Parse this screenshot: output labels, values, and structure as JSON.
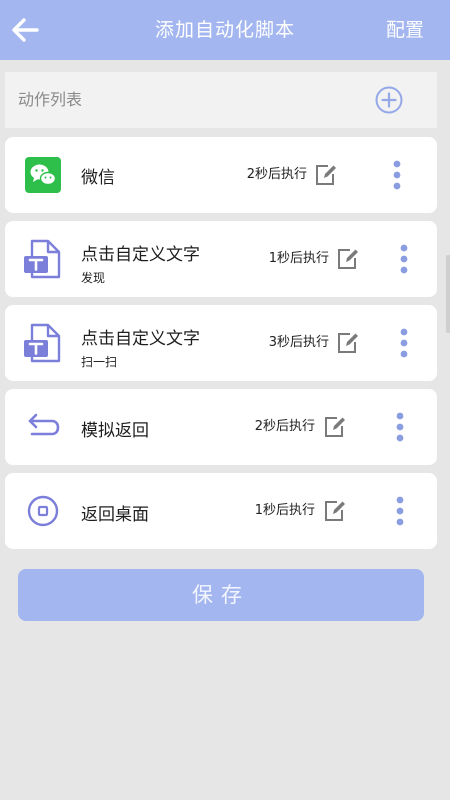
{
  "header": {
    "title": "添加自动化脚本",
    "config_label": "配置"
  },
  "list": {
    "label": "动作列表"
  },
  "actions": [
    {
      "title": "微信",
      "subtitle": "",
      "delay": "2秒后执行",
      "icon": "wechat-icon"
    },
    {
      "title": "点击自定义文字",
      "subtitle": "发现",
      "delay": "1秒后执行",
      "icon": "text-tool-icon"
    },
    {
      "title": "点击自定义文字",
      "subtitle": "扫一扫",
      "delay": "3秒后执行",
      "icon": "text-tool-icon"
    },
    {
      "title": "模拟返回",
      "subtitle": "",
      "delay": "2秒后执行",
      "icon": "back-arrow-icon"
    },
    {
      "title": "返回桌面",
      "subtitle": "",
      "delay": "1秒后执行",
      "icon": "home-circle-icon"
    }
  ],
  "save_label": "保存",
  "colors": {
    "accent": "#a3b6ef",
    "icon_purple": "#7b7fd9",
    "wechat_green": "#2dbf4a",
    "background": "#e6e6e6"
  }
}
